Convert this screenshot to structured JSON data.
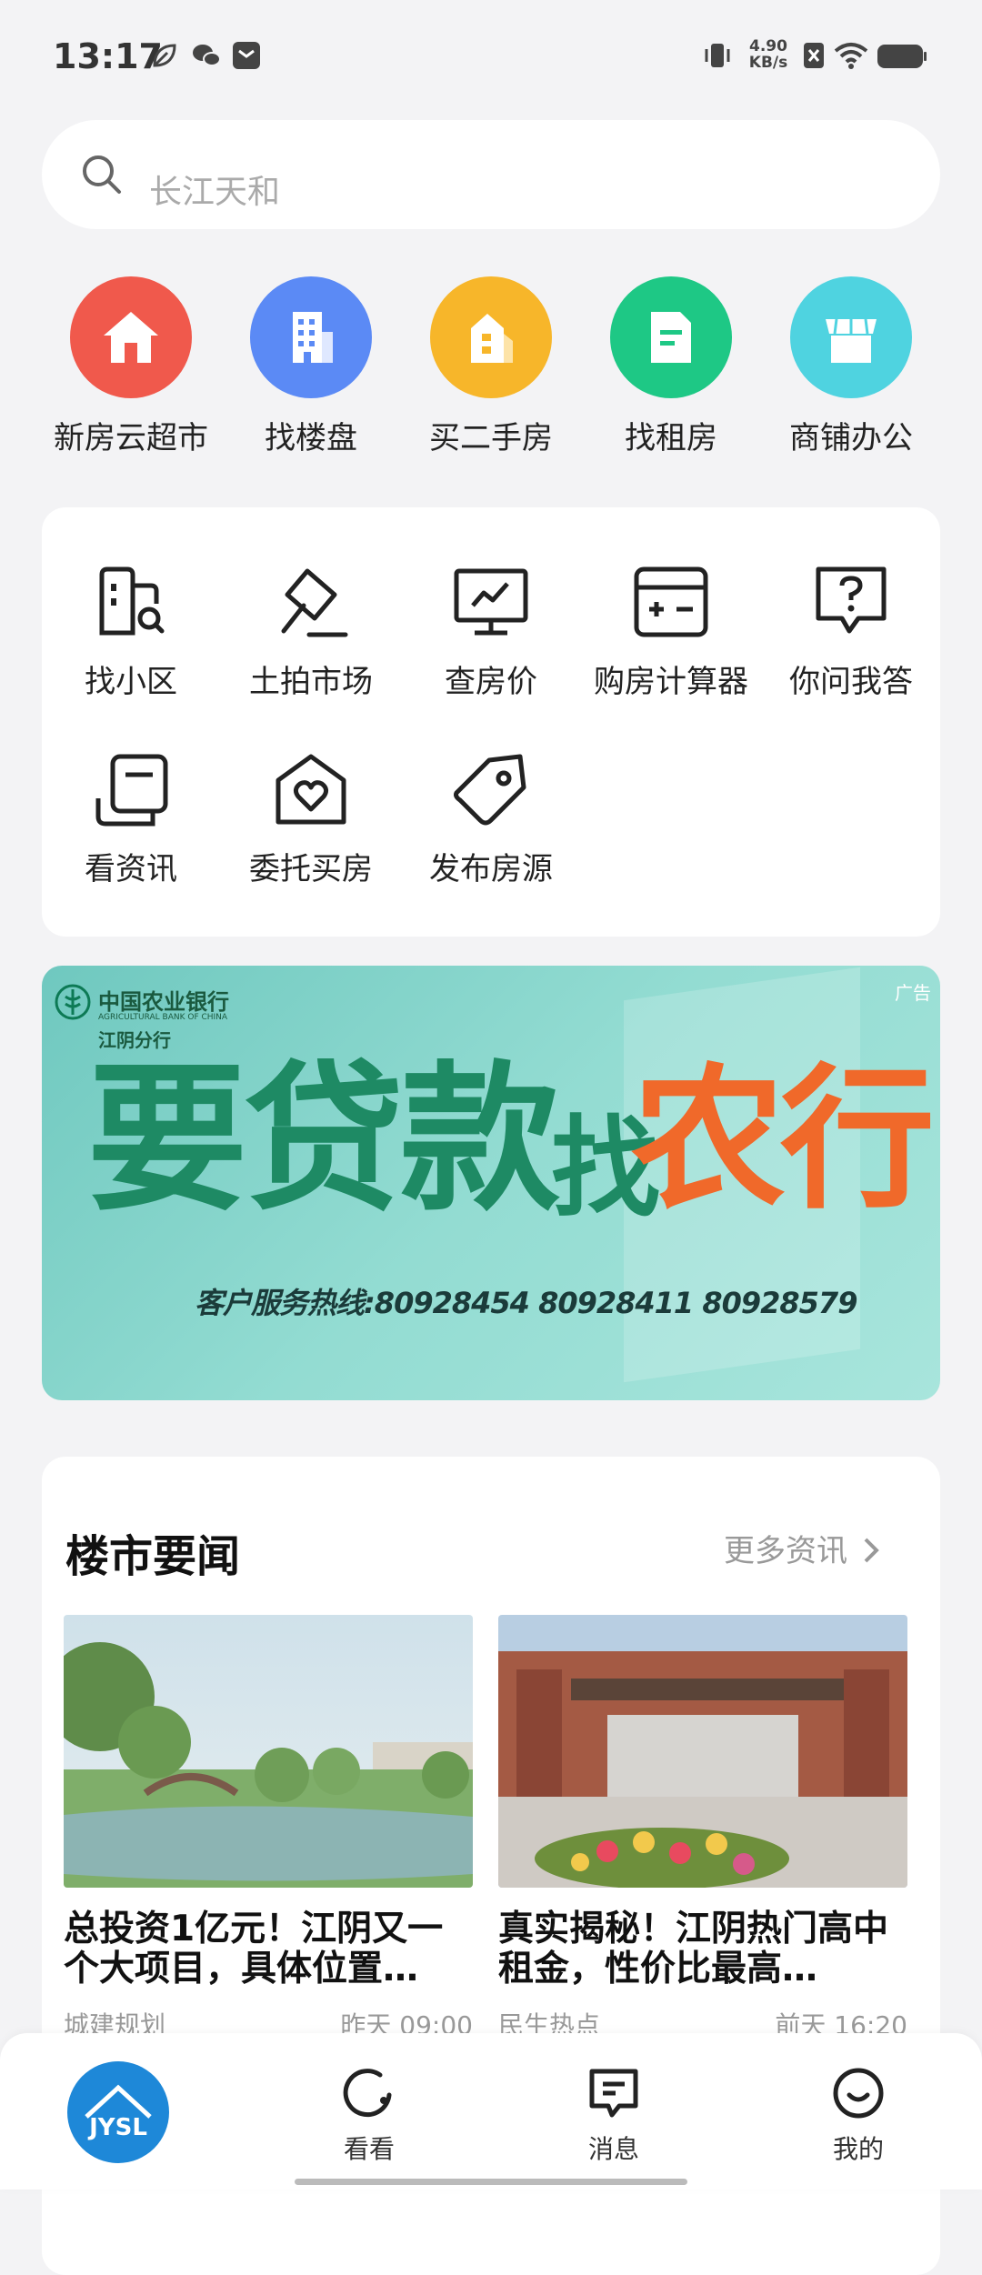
{
  "status": {
    "time": "13:17",
    "net_speed_top": "4.90",
    "net_speed_unit": "KB/s"
  },
  "search": {
    "placeholder": "长江天和"
  },
  "quick": [
    {
      "label": "新房云超市",
      "color": "#f0594c",
      "icon": "house-icon"
    },
    {
      "label": "找楼盘",
      "color": "#5b8af5",
      "icon": "building-icon"
    },
    {
      "label": "买二手房",
      "color": "#f7b62a",
      "icon": "secondhand-house-icon"
    },
    {
      "label": "找租房",
      "color": "#1ec885",
      "icon": "rent-doc-icon"
    },
    {
      "label": "商铺办公",
      "color": "#4fd3e0",
      "icon": "shop-icon"
    }
  ],
  "tools": [
    {
      "label": "找小区"
    },
    {
      "label": "土拍市场"
    },
    {
      "label": "查房价"
    },
    {
      "label": "购房计算器"
    },
    {
      "label": "你问我答"
    },
    {
      "label": "看资讯"
    },
    {
      "label": "委托买房"
    },
    {
      "label": "发布房源"
    }
  ],
  "ad": {
    "tag": "广告",
    "bank_cn": "中国农业银行",
    "bank_en": "AGRICULTURAL BANK OF CHINA",
    "branch": "江阴分行",
    "slogan_a": "要贷款",
    "slogan_b": "找",
    "slogan_c": "农行",
    "hotline": "客户服务热线:80928454 80928411 80928579"
  },
  "news": {
    "title": "楼市要闻",
    "more": "更多资讯",
    "items": [
      {
        "headline": "总投资1亿元！江阴又一个大项目，具体位置…",
        "category": "城建规划",
        "time": "昨天 09:00"
      },
      {
        "headline": "真实揭秘！江阴热门高中租金，性价比最高…",
        "category": "民生热点",
        "time": "前天 16:20"
      }
    ]
  },
  "nav": [
    {
      "label": ""
    },
    {
      "label": "看看"
    },
    {
      "label": "消息"
    },
    {
      "label": "我的"
    }
  ],
  "logo_text": "JYSL"
}
